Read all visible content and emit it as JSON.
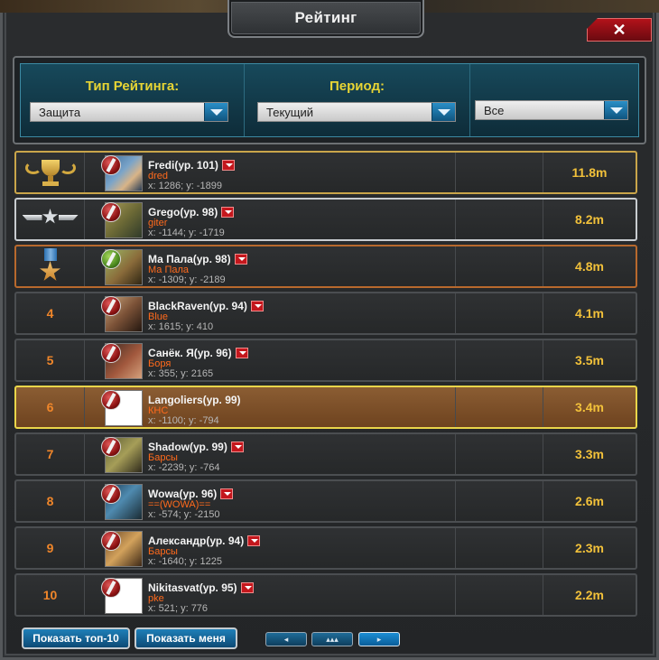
{
  "window": {
    "title": "Рейтинг",
    "close_label": "✕"
  },
  "filters": {
    "type_label": "Тип Рейтинга:",
    "type_value": "Защита",
    "period_label": "Период:",
    "period_value": "Текущий",
    "scope_value": "Все"
  },
  "rows": [
    {
      "rank": "",
      "rank_icon": "gold-trophy-icon",
      "name": "Fredi(ур. 101)",
      "clan": "dred",
      "coords": "x: 1286; y: -1899",
      "score": "11.8m"
    },
    {
      "rank": "",
      "rank_icon": "silver-wings-icon",
      "name": "Grego(ур. 98)",
      "clan": "giter",
      "coords": "x: -1144; y: -1719",
      "score": "8.2m"
    },
    {
      "rank": "",
      "rank_icon": "bronze-medal-icon",
      "name": "Ма Пала(ур. 98)",
      "clan": "Ма Пала",
      "coords": "x: -1309; y: -2189",
      "score": "4.8m"
    },
    {
      "rank": "4",
      "name": "BlackRaven(ур. 94)",
      "clan": "Blue",
      "coords": "x: 1615; y: 410",
      "score": "4.1m"
    },
    {
      "rank": "5",
      "name": "Санёк. Я(ур. 96)",
      "clan": "Боря",
      "coords": "x: 355; y: 2165",
      "score": "3.5m"
    },
    {
      "rank": "6",
      "name": "Langoliers(ур. 99)",
      "clan": "КНС",
      "coords": "x: -1100; y: -794",
      "score": "3.4m"
    },
    {
      "rank": "7",
      "name": "Shadow(ур. 99)",
      "clan": "Барсы",
      "coords": "x: -2239; y: -764",
      "score": "3.3m"
    },
    {
      "rank": "8",
      "name": "Wowa(ур. 96)",
      "clan": "==(WOWA)==",
      "coords": "x: -574; y: -2150",
      "score": "2.6m"
    },
    {
      "rank": "9",
      "name": "Александр(ур. 94)",
      "clan": "Барсы",
      "coords": "x: -1640; y: 1225",
      "score": "2.3m"
    },
    {
      "rank": "10",
      "name": "Nikitasvat(ур. 95)",
      "clan": "pke",
      "coords": "x: 521; y: 776",
      "score": "2.2m"
    }
  ],
  "footer": {
    "top10_label": "Показать топ-10",
    "showme_label": "Показать меня",
    "prev_label": "◂",
    "up_label": "▴▴▴",
    "next_label": "▸"
  }
}
